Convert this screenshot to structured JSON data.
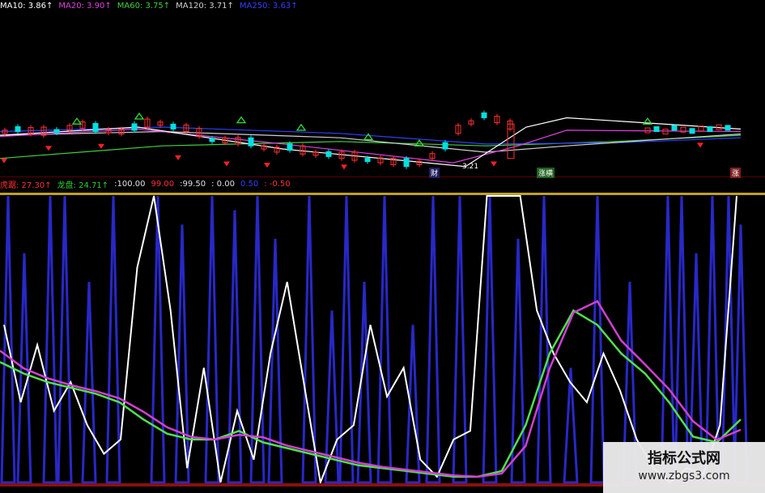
{
  "top_legend": {
    "ma10": "MA10: 3.86↑",
    "ma20": "MA20: 3.90↑",
    "ma60": "MA60: 3.75↑",
    "ma120": "MA120: 3.71↑",
    "ma250": "MA250: 3.63↑"
  },
  "indicator_legend": {
    "tiger": "虎踞: 27.30↑",
    "dragon": "龙盘: 24.71↑",
    "v3": ":100.00",
    "v4": "99.00",
    "v5": ":99.50",
    "v6": ": 0.00",
    "v7": "0.50",
    "v8": ": -0.50"
  },
  "chart_tags": {
    "cai": "财",
    "low": "3.21",
    "zhang1": "涨横",
    "zhang2": "涨"
  },
  "watermark": {
    "title": "指标公式网",
    "url": "www.zbgs3.com"
  },
  "colors": {
    "ma10": "#ffffff",
    "ma20": "#e040e0",
    "ma60": "#40d040",
    "ma120": "#d0d0d0",
    "ma250": "#3040ff",
    "white_line": "#ffffff",
    "magenta_line": "#d040d0",
    "green_line": "#50e050",
    "blue_bars": "#2828c8",
    "separator": "#c0a020"
  },
  "chart_data": {
    "type": "line",
    "title": "",
    "series": [
      {
        "name": "虎踞",
        "values": [
          55,
          28,
          48,
          25,
          35,
          20,
          10,
          15,
          75,
          100,
          60,
          5,
          40,
          0,
          25,
          8,
          45,
          70,
          35,
          0,
          15,
          20,
          55,
          30,
          40,
          8,
          2,
          15,
          18,
          100,
          100,
          100,
          60,
          45,
          35,
          28,
          45,
          32,
          15,
          5,
          0,
          5,
          3,
          20,
          100
        ]
      },
      {
        "name": "龙盘",
        "values": [
          42,
          38,
          35,
          33,
          31,
          28,
          22,
          17,
          15,
          15,
          18,
          14,
          12,
          10,
          8,
          6,
          5,
          4,
          3,
          2,
          2,
          4,
          20,
          45,
          60,
          55,
          45,
          38,
          28,
          16,
          14,
          22
        ]
      }
    ]
  }
}
